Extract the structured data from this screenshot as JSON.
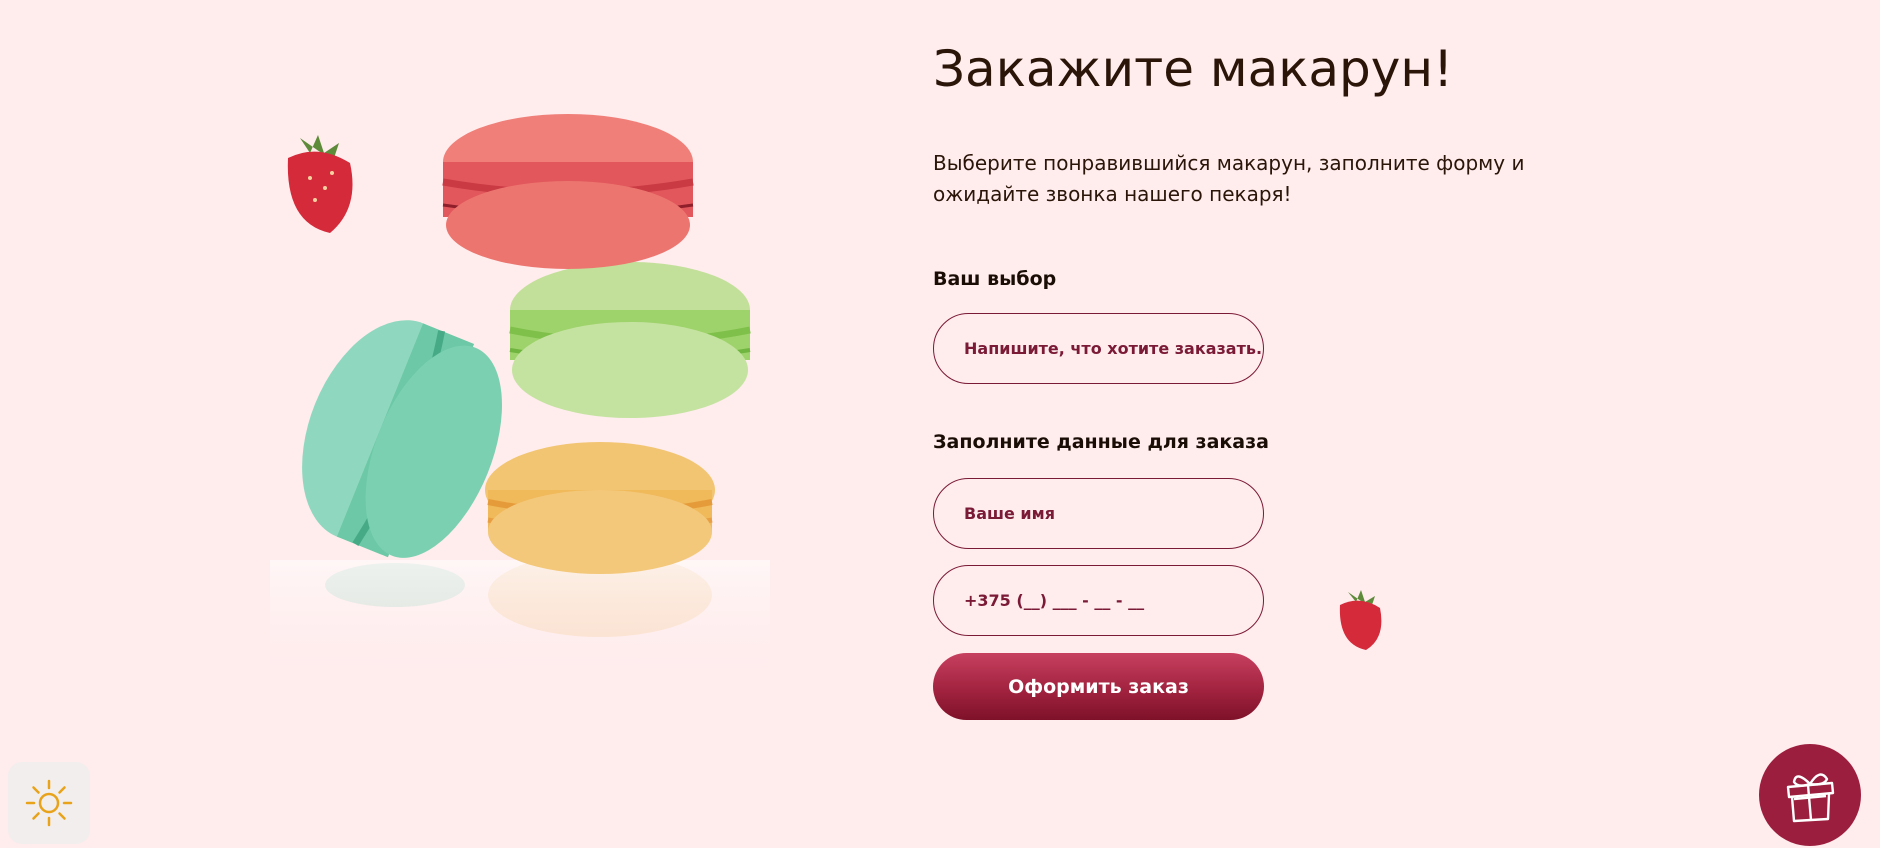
{
  "order": {
    "title": "Закажите макарун!",
    "subtitle": "Выберите понравившийся макарун, заполните форму и ожидайте звонка нашего пекаря!",
    "choice_label": "Ваш выбор",
    "choice_placeholder": "Напишите, что хотите заказать...",
    "data_label": "Заполните данные для заказа",
    "name_placeholder": "Ваше имя",
    "phone_placeholder": "+375 (__) ___ - __ - __",
    "submit_label": "Оформить заказ"
  },
  "icons": {
    "theme": "sun-icon",
    "gift": "gift-icon"
  },
  "colors": {
    "background": "#ffeced",
    "accent": "#9c1e3e",
    "field_text": "#7a1a36",
    "heading": "#2a1508",
    "sun": "#e8a31a"
  }
}
